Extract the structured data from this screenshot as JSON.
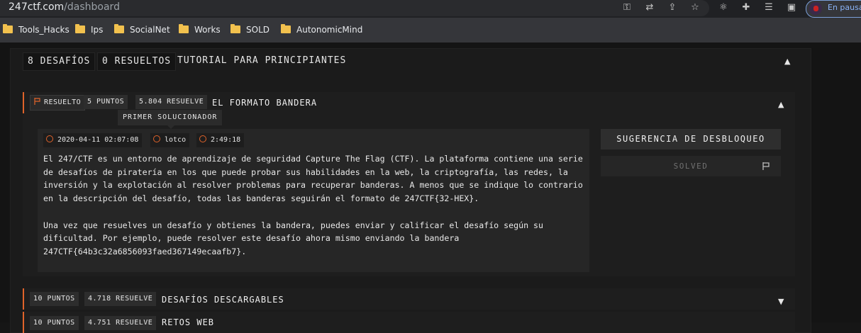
{
  "browser": {
    "url_host": "247ctf.com",
    "url_path": "/dashboard",
    "profile_label": "En pausa",
    "bookmarks": [
      "Tools_Hacks",
      "Ips",
      "SocialNet",
      "Works",
      "SOLD",
      "AutonomicMind"
    ]
  },
  "tabs": {
    "challenges": "8 DESAFÍOS",
    "solved": "0 RESUELTOS",
    "tutorial": "TUTORIAL PARA PRINCIPIANTES"
  },
  "challenges": [
    {
      "status": "RESUELTO",
      "points": "5 PUNTOS",
      "solves": "5.804 RESUELVE",
      "title": "EL FORMATO BANDERA",
      "tooltip": "PRIMER SOLUCIONADOR",
      "first_solve_date": "2020-04-11 02:07:08",
      "first_solver": "lotco",
      "first_solve_time": "2:49:18",
      "description": "El 247/CTF es un entorno de aprendizaje de seguridad Capture The Flag (CTF). La plataforma contiene una serie de desafíos de piratería en los que puede probar sus habilidades en la web, la criptografía, las redes, la inversión y la explotación al resolver problemas para recuperar banderas. A menos que se indique lo contrario en la descripción del desafío, todas las banderas seguirán el formato de 247CTF{32-HEX}.\n\nUna vez que resuelves un desafío y obtienes la bandera, puedes enviar y calificar el desafío según su dificultad. Por ejemplo, puede resolver este desafío ahora mismo enviando la bandera 247CTF{64b3c32a6856093faed367149ecaafb7}.",
      "hint_button": "SUGERENCIA DE DESBLOQUEO",
      "solved_button": "SOLVED"
    },
    {
      "points": "10 PUNTOS",
      "solves": "4.718 RESUELVE",
      "title": "DESAFÍOS DESCARGABLES"
    },
    {
      "points": "10 PUNTOS",
      "solves": "4.751 RESUELVE",
      "title": "RETOS WEB"
    }
  ],
  "colors": {
    "accent": "#e0632a",
    "background": "#141414"
  }
}
